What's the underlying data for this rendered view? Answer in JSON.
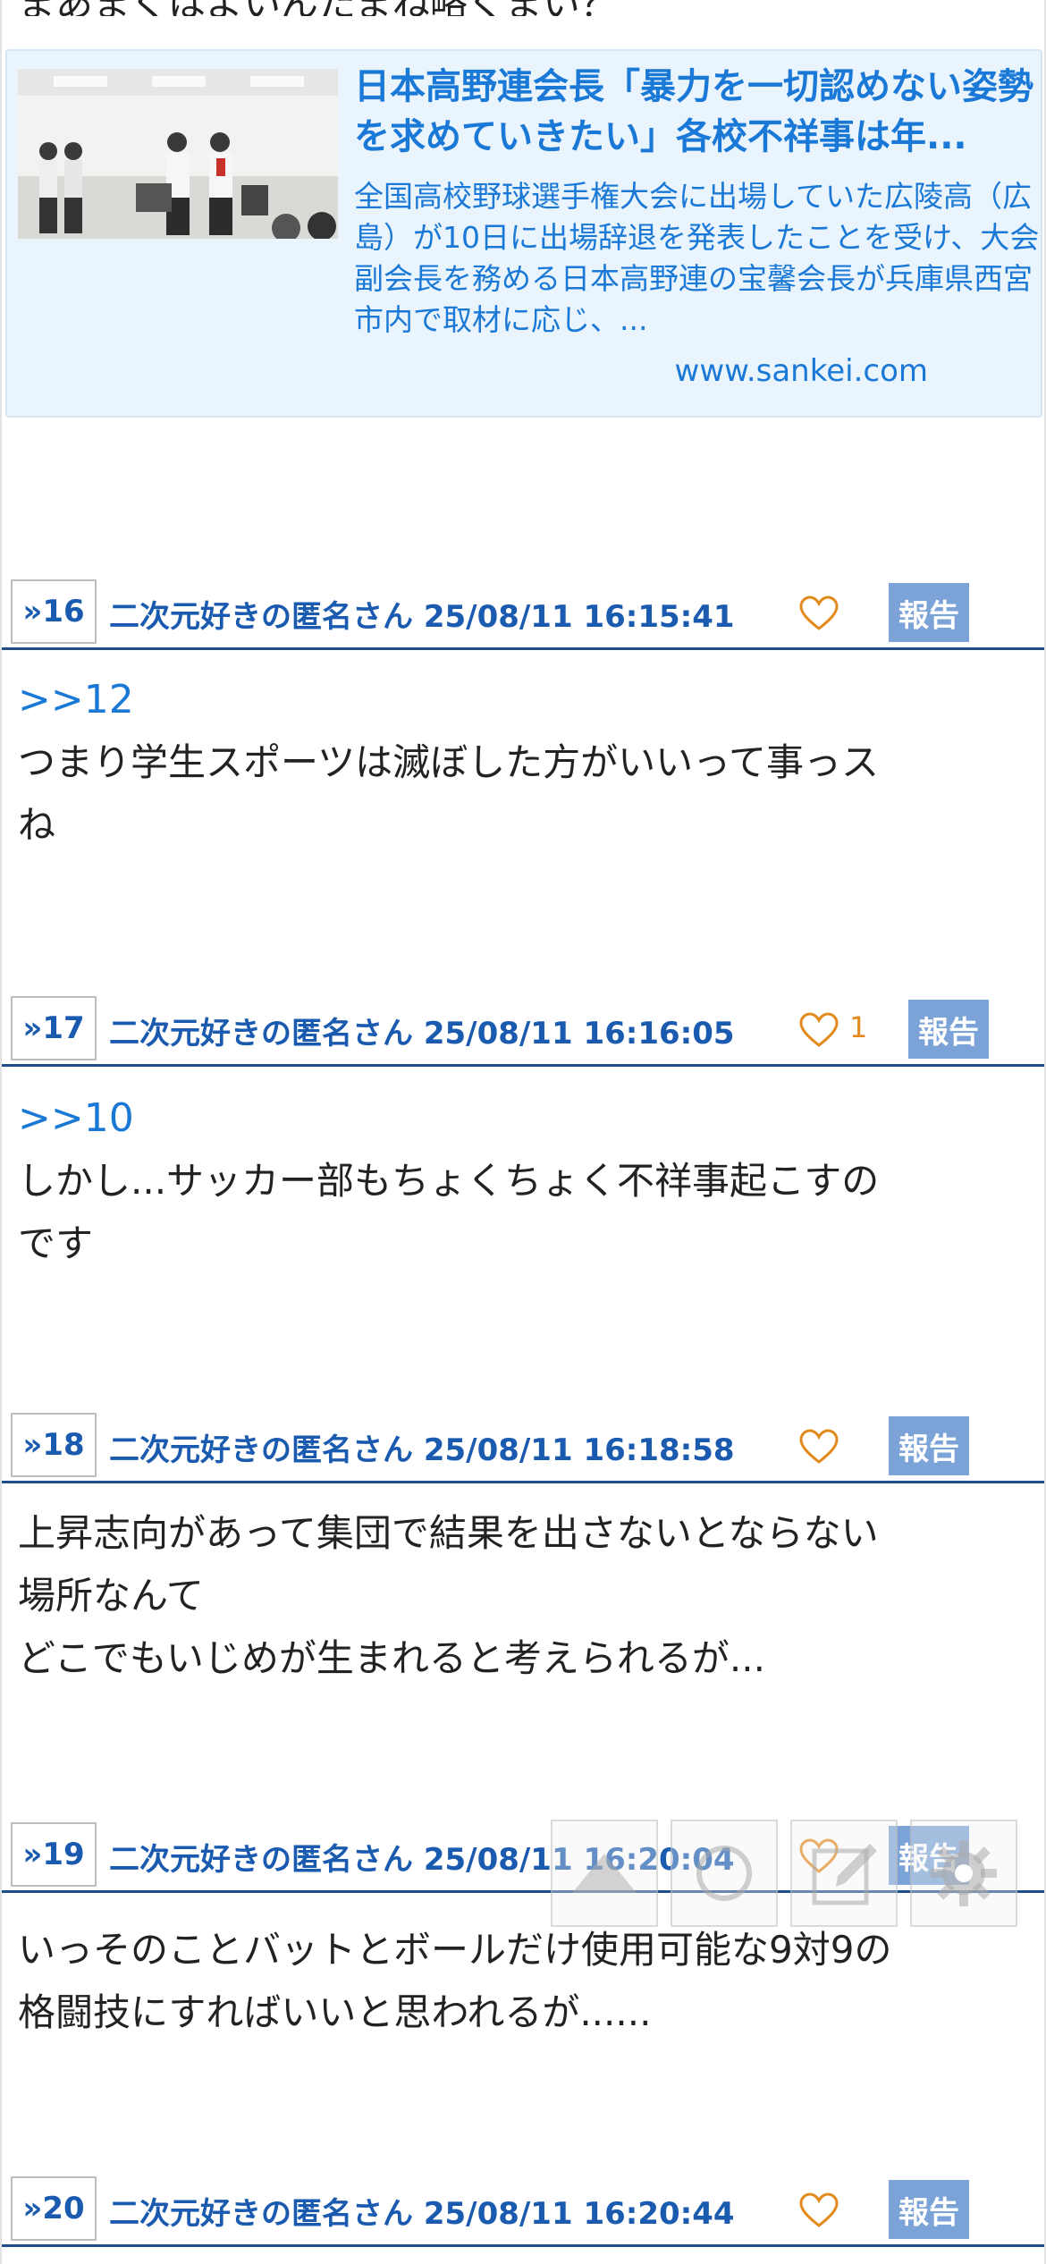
{
  "previous_post_tail": "まあまくはよいんたまね略くまい？",
  "link_card": {
    "title": "日本高野連会長「暴力を一切認めない姿勢を求めていきたい」各校不祥事は年...",
    "description": "全国高校野球選手権大会に出場していた広陵高（広島）が10日に出場辞退を発表したことを受け、大会副会長を務める日本高野連の宝馨会長が兵庫県西宮市内で取材に応じ、...",
    "url": "www.sankei.com"
  },
  "posts": [
    {
      "num": "»16",
      "meta": "二次元好きの匿名さん 25/08/11 16:15:41",
      "likes": "",
      "report": "報告",
      "anchor": "",
      "lines": []
    },
    {
      "num": "»17",
      "meta": "二次元好きの匿名さん 25/08/11 16:16:05",
      "likes": "1",
      "report": "報告",
      "anchor": ">>12",
      "lines": [
        "つまり学生スポーツは滅ぼした方がいいって事っス",
        "ね"
      ]
    },
    {
      "num": "»18",
      "meta": "二次元好きの匿名さん 25/08/11 16:18:58",
      "likes": "",
      "report": "報告",
      "anchor": ">>10",
      "lines": [
        "しかし...サッカー部もちょくちょく不祥事起こすの",
        "です"
      ]
    },
    {
      "num": "»19",
      "meta": "二次元好きの匿名さん 25/08/11 16:20:04",
      "likes": "",
      "report": "報告",
      "anchor": "",
      "lines": [
        "上昇志向があって集団で結果を出さないとならない",
        "場所なんて",
        "どこでもいじめが生まれると考えられるが..."
      ]
    },
    {
      "num": "»20",
      "meta": "二次元好きの匿名さん 25/08/11 16:20:44",
      "likes": "",
      "report": "報告",
      "anchor": "",
      "lines": [
        "いっそのことバットとボールだけ使用可能な9対9の",
        "格闘技にすればいいと思われるが......"
      ]
    }
  ],
  "floating_toolbar": {
    "icons": [
      "scroll-top-icon",
      "refresh-icon",
      "compose-icon",
      "settings-icon"
    ]
  },
  "colors": {
    "link_blue": "#1a78d6",
    "header_blue": "#1a5bb0",
    "rule_navy": "#1f4e8a",
    "report_bg": "#7ca3d7",
    "card_bg": "#eaf4fd",
    "like_orange": "#e38a1c"
  }
}
